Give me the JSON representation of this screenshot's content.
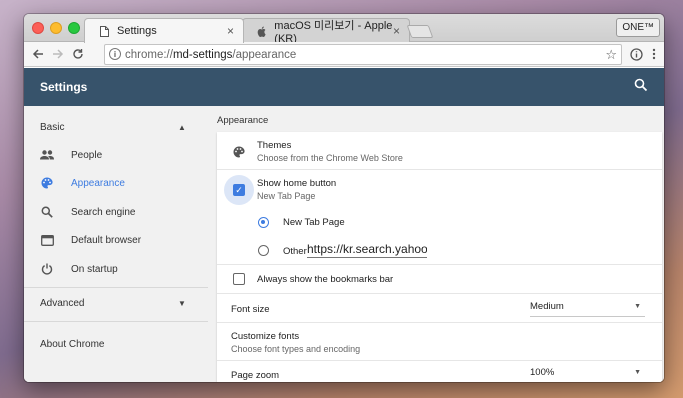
{
  "browser": {
    "tabs": [
      {
        "title": "Settings",
        "icon": "document-icon",
        "active": true
      },
      {
        "title": "macOS 미리보기 - Apple (KR)",
        "icon": "apple-icon",
        "active": false
      }
    ],
    "close_glyph": "×",
    "profile_label": "ONE™",
    "url": {
      "scheme": "chrome://",
      "host": "md-settings",
      "path": "/appearance"
    }
  },
  "header": {
    "title": "Settings"
  },
  "sidebar": {
    "basic_label": "Basic",
    "items": [
      {
        "label": "People",
        "icon": "people-icon"
      },
      {
        "label": "Appearance",
        "icon": "palette-icon",
        "active": true
      },
      {
        "label": "Search engine",
        "icon": "search-icon"
      },
      {
        "label": "Default browser",
        "icon": "browser-window-icon"
      },
      {
        "label": "On startup",
        "icon": "power-icon"
      }
    ],
    "advanced_label": "Advanced",
    "about_label": "About Chrome"
  },
  "appearance": {
    "section_title": "Appearance",
    "themes": {
      "title": "Themes",
      "subtitle": "Choose from the Chrome Web Store"
    },
    "home_button": {
      "title": "Show home button",
      "subtitle": "New Tab Page",
      "checked": true
    },
    "radio_new_tab": {
      "label": "New Tab Page",
      "selected": true
    },
    "radio_other": {
      "label": "Other",
      "value": "https://kr.search.yahoo."
    },
    "bookmarks_bar": {
      "title": "Always show the bookmarks bar",
      "checked": false
    },
    "font_size": {
      "label": "Font size",
      "value": "Medium"
    },
    "customize_fonts": {
      "title": "Customize fonts",
      "subtitle": "Choose font types and encoding"
    },
    "page_zoom": {
      "label": "Page zoom",
      "value": "100%"
    }
  },
  "colors": {
    "accent": "#3e7ce0",
    "header_bg": "#37536b"
  }
}
